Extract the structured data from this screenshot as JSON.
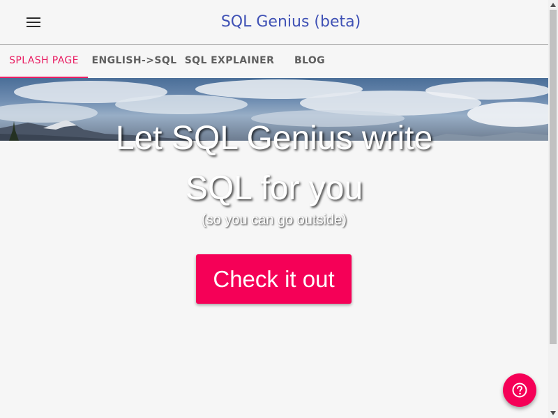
{
  "app": {
    "title": "SQL Genius (beta)",
    "menu_icon": "hamburger-menu-icon"
  },
  "tabs": [
    {
      "label": "SPLASH PAGE",
      "active": true
    },
    {
      "label": "ENGLISH->SQL",
      "active": false
    },
    {
      "label": "SQL EXPLAINER",
      "active": false
    },
    {
      "label": "BLOG",
      "active": false
    }
  ],
  "hero": {
    "headline_line1": "Let SQL Genius write",
    "headline_line2": "SQL for you",
    "subheadline": "(so you can go outside)",
    "cta_label": "Check it out"
  },
  "fab": {
    "icon": "help-circle-icon"
  },
  "colors": {
    "title": "#3f51b5",
    "accent": "#e91e63",
    "cta": "#f50057",
    "background": "#f6f6f6"
  }
}
